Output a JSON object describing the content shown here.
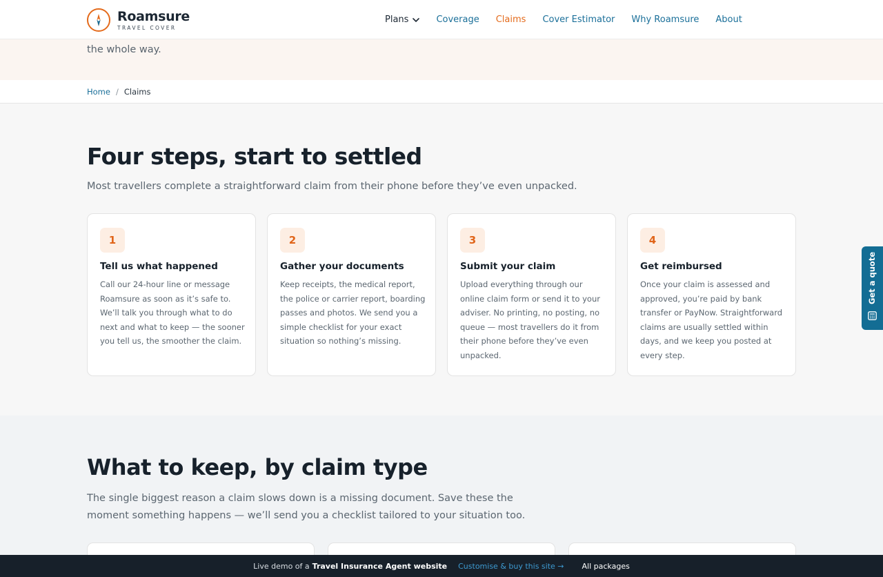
{
  "brand": {
    "name": "Roamsure",
    "tagline": "TRAVEL COVER",
    "accent": "#e46b1c",
    "link_color": "#1a6f99"
  },
  "nav": {
    "items": [
      {
        "label": "Plans"
      },
      {
        "label": "Coverage"
      },
      {
        "label": "Claims"
      },
      {
        "label": "Cover Estimator"
      },
      {
        "label": "Why Roamsure"
      },
      {
        "label": "About"
      }
    ],
    "active": "Claims"
  },
  "hero": {
    "text_fragment": "the whole way."
  },
  "breadcrumb": {
    "home": "Home",
    "separator": "/",
    "current": "Claims"
  },
  "steps_section": {
    "title": "Four steps, start to settled",
    "lead": "Most travellers complete a straightforward claim from their phone before they’ve even unpacked.",
    "steps": [
      {
        "number": "1",
        "title": "Tell us what happened",
        "body": "Call our 24-hour line or message Roamsure as soon as it’s safe to. We’ll talk you through what to do next and what to keep — the sooner you tell us, the smoother the claim."
      },
      {
        "number": "2",
        "title": "Gather your documents",
        "body": "Keep receipts, the medical report, the police or carrier report, boarding passes and photos. We send you a simple checklist for your exact situation so nothing’s missing."
      },
      {
        "number": "3",
        "title": "Submit your claim",
        "body": "Upload everything through our online claim form or send it to your adviser. No printing, no posting, no queue — most travellers do it from their phone before they’ve even unpacked."
      },
      {
        "number": "4",
        "title": "Get reimbursed",
        "body": "Once your claim is assessed and approved, you’re paid by bank transfer or PayNow. Straightforward claims are usually settled within days, and we keep you posted at every step."
      }
    ]
  },
  "keep_section": {
    "title": "What to keep, by claim type",
    "lead": "The single biggest reason a claim slows down is a missing document. Save these the moment something happens — we’ll send you a checklist tailored to your situation too."
  },
  "side_tab": {
    "label": "Get a quote",
    "icon": "calculator-icon"
  },
  "demo_bar": {
    "prefix": "Live demo of a",
    "site_type": "Travel Insurance Agent website",
    "buy_link": "Customise & buy this site →",
    "packages_link": "All packages"
  }
}
